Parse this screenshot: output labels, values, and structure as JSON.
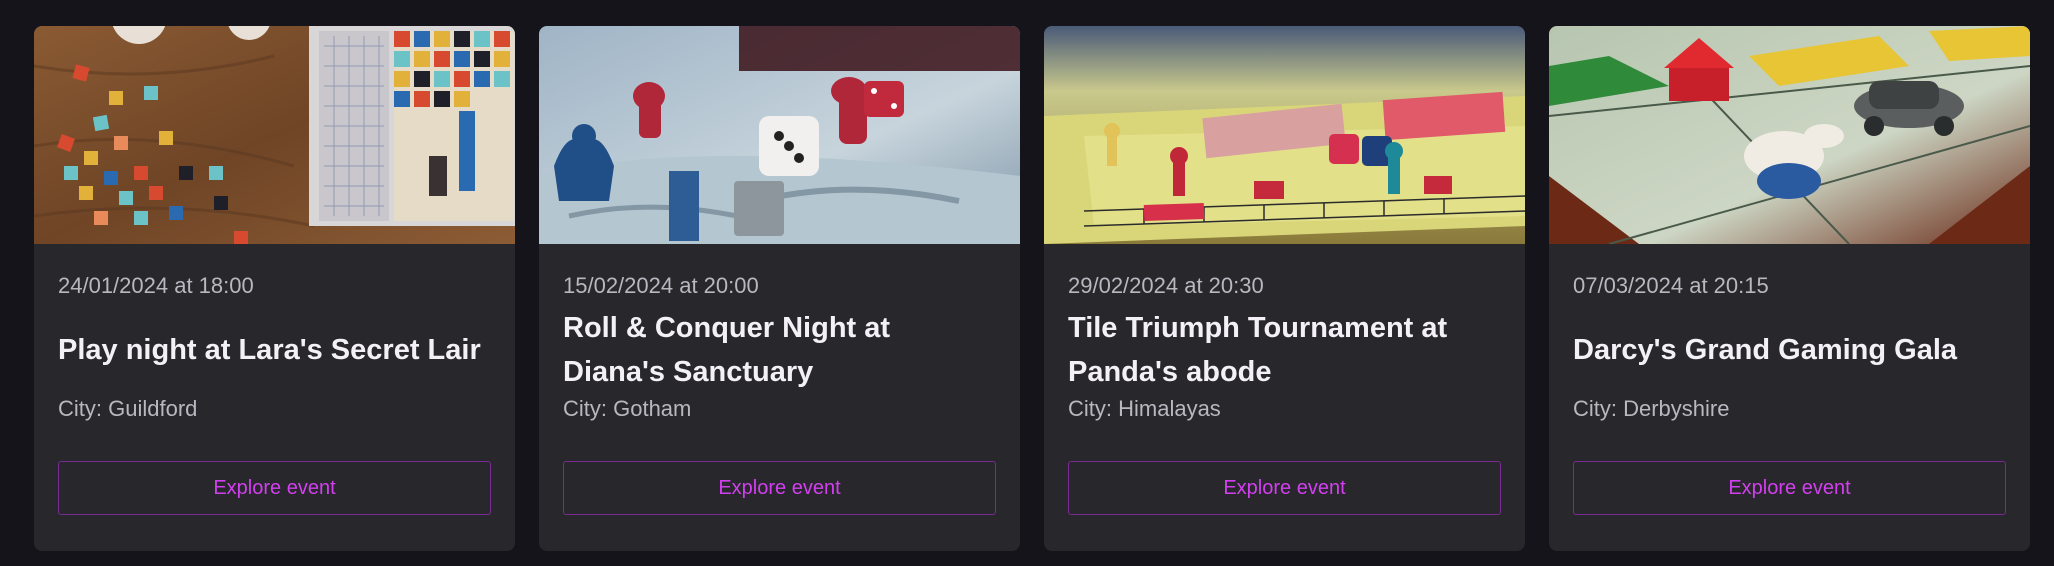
{
  "events": [
    {
      "date": "24/01/2024 at 18:00",
      "title": "Play night at Lara's Secret Lair",
      "city": "City: Guildford",
      "button": "Explore event",
      "image": "azul-tiles-board-photo"
    },
    {
      "date": "15/02/2024 at 20:00",
      "title": "Roll & Conquer Night at Diana's Sanctuary",
      "city": "City: Gotham",
      "button": "Explore event",
      "image": "meeples-dice-board-photo"
    },
    {
      "date": "29/02/2024 at 20:30",
      "title": "Tile Triumph Tournament at Panda's abode",
      "city": "City: Himalayas",
      "button": "Explore event",
      "image": "yellow-board-pawns-photo"
    },
    {
      "date": "07/03/2024 at 20:15",
      "title": "Darcy's Grand Gaming Gala",
      "city": "City: Derbyshire",
      "button": "Explore event",
      "image": "monopoly-board-photo"
    }
  ],
  "colors": {
    "background": "#15141b",
    "card": "#28272c",
    "accent": "#d33ff0",
    "button_border": "#7a2a93"
  }
}
